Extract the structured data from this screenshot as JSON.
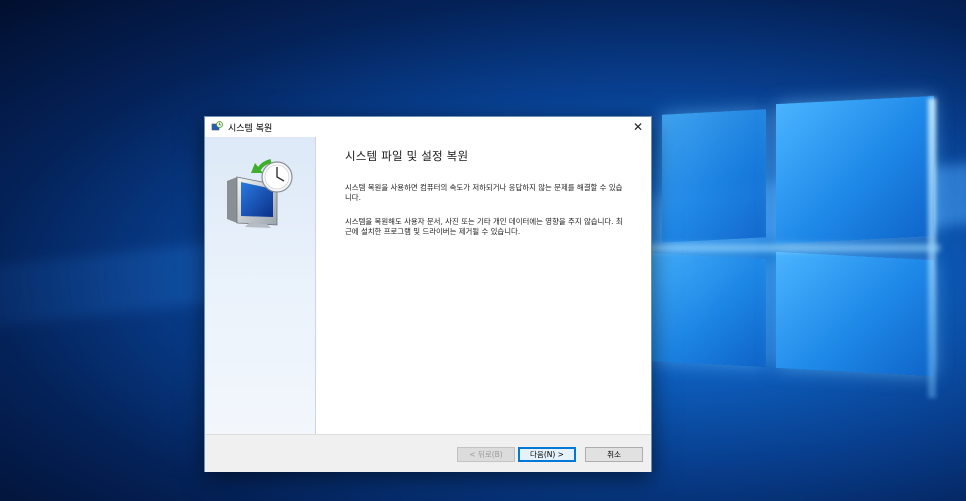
{
  "window": {
    "title": "시스템 복원",
    "close_glyph": "✕"
  },
  "content": {
    "heading": "시스템 파일 및 설정 복원",
    "paragraph1": "시스템 복원을 사용하면 컴퓨터의 속도가 저하되거나 응답하지 않는 문제를 해결할 수 있습니다.",
    "paragraph2": "시스템을 복원해도 사용자 문서, 사진 또는 기타 개인 데이터에는 영향을 주지 않습니다. 최근에 설치한 프로그램 및 드라이버는 제거될 수 있습니다."
  },
  "buttons": {
    "back_label": "< 뒤로(B)",
    "next_label": "다음(N) >",
    "cancel_label": "취소"
  },
  "colors": {
    "accent": "#0078d7",
    "desktop_blue": "#0e63c4"
  },
  "icons": {
    "title": "system-restore-icon",
    "hero": "system-restore-monitor-clock-icon"
  }
}
